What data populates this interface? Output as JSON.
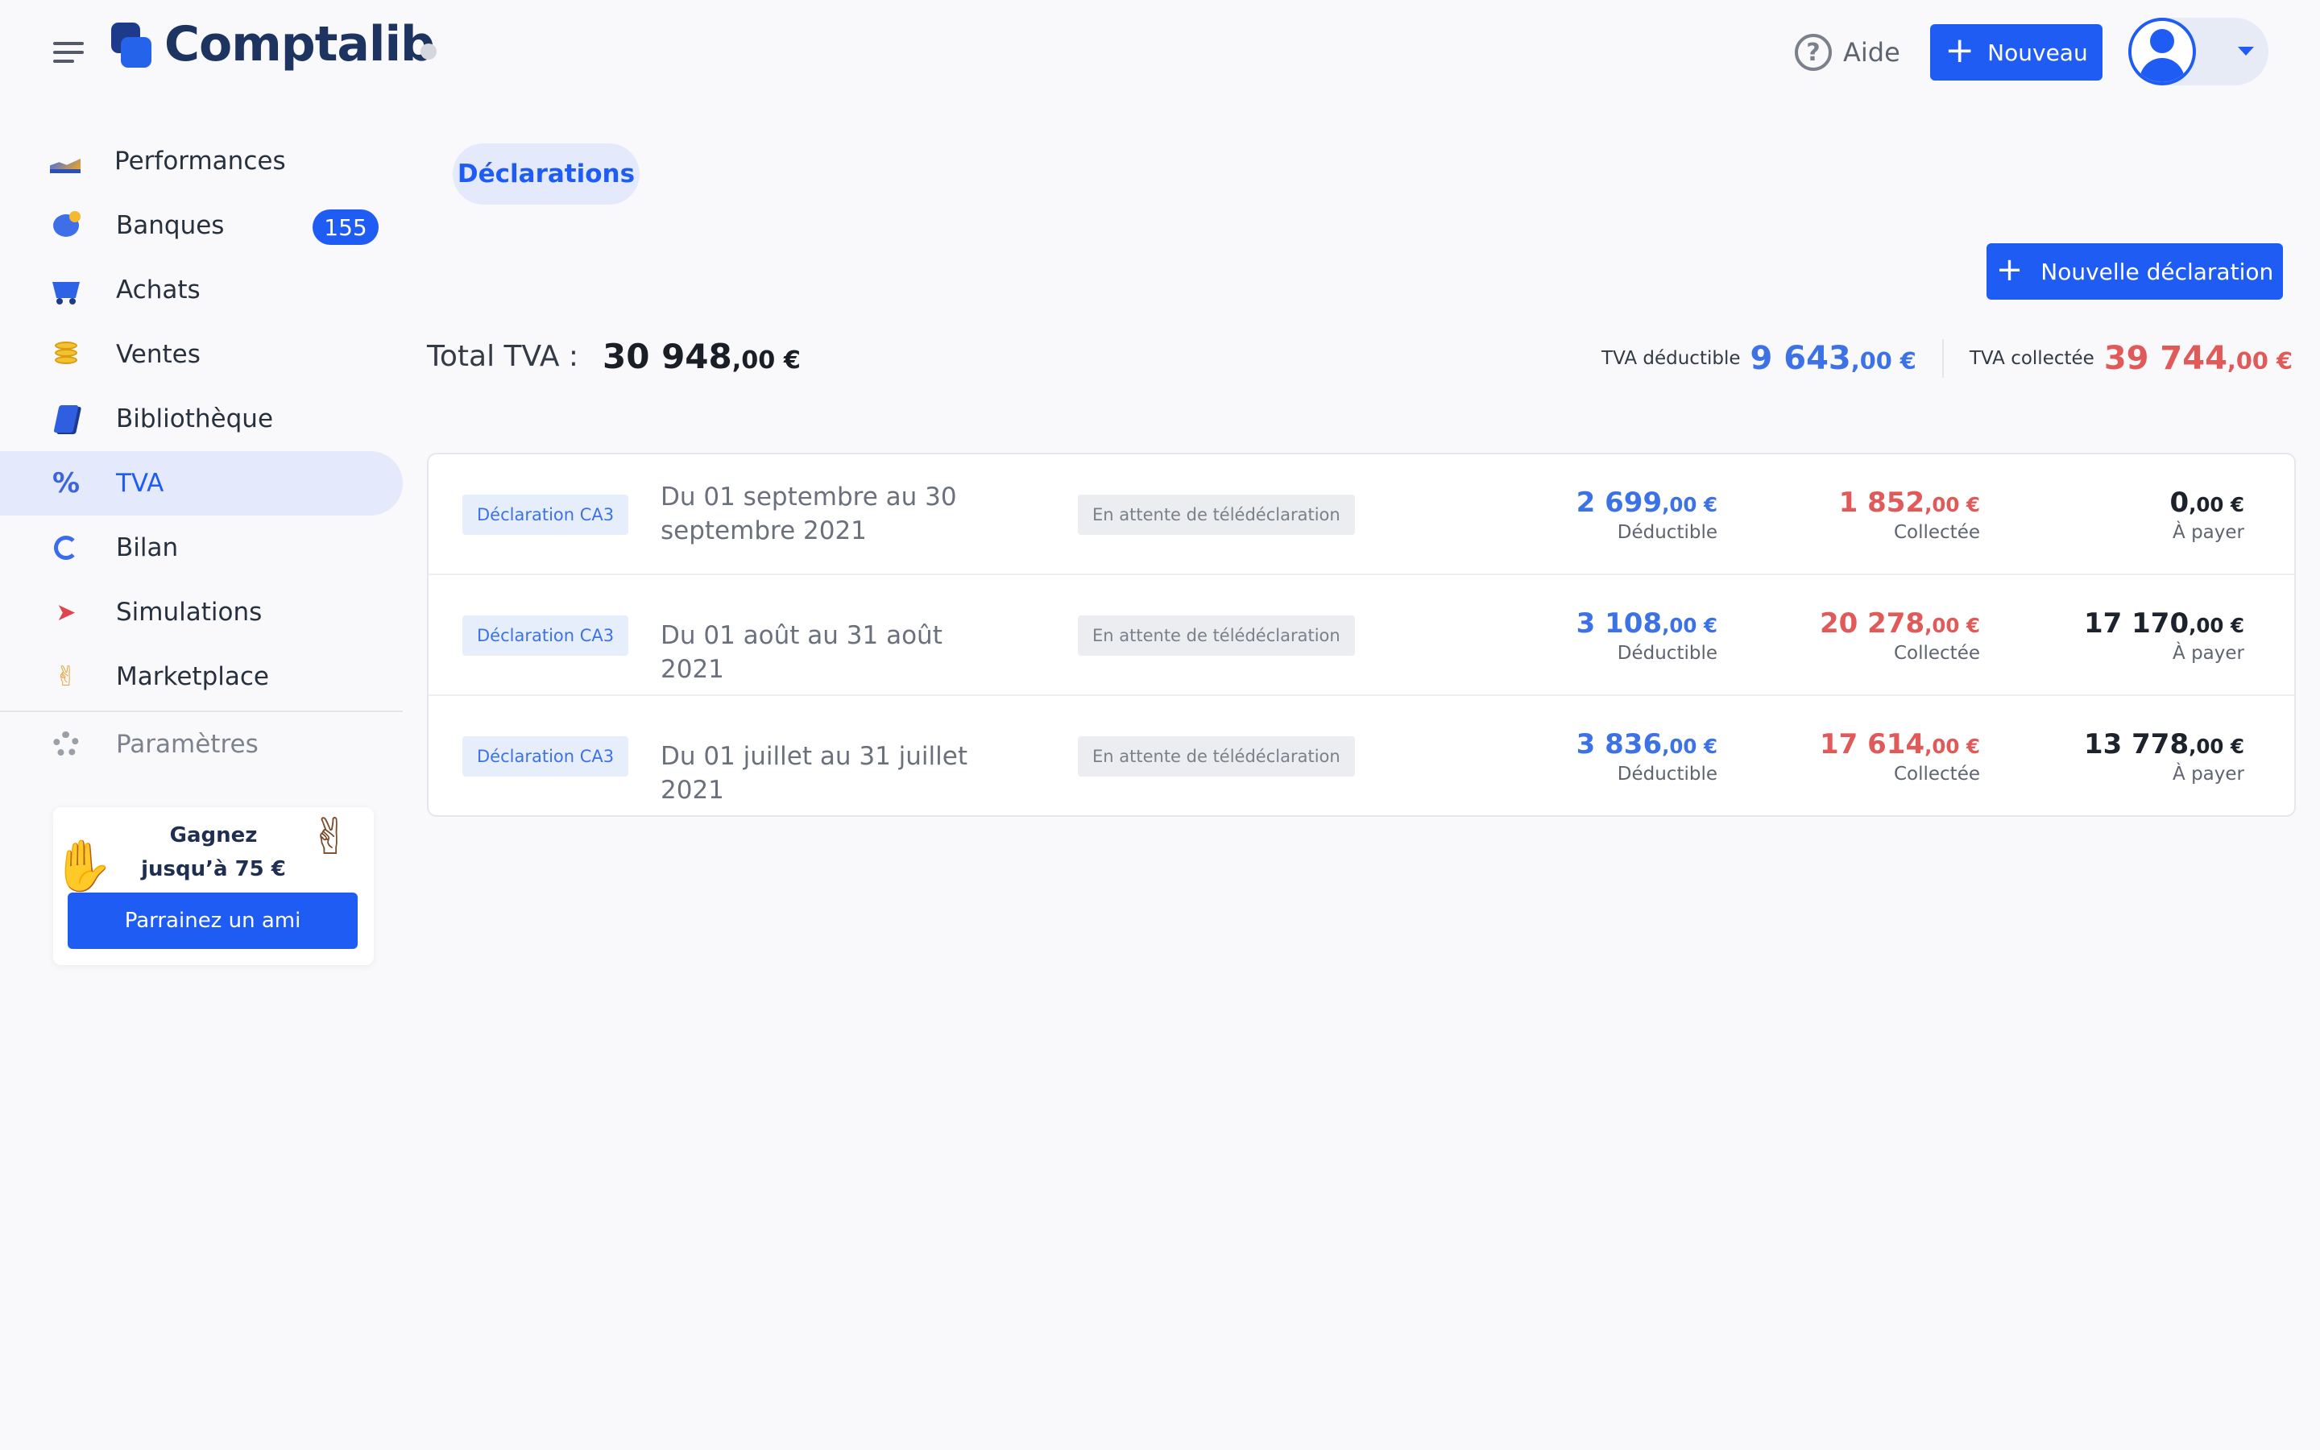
{
  "header": {
    "brand": "Comptalib",
    "help_label": "Aide",
    "help_icon": "?",
    "new_button_label": "Nouveau"
  },
  "sidebar": {
    "items": [
      {
        "label": "Performances",
        "icon": "chart-icon"
      },
      {
        "label": "Banques",
        "icon": "piggy-bank-icon",
        "badge": "155"
      },
      {
        "label": "Achats",
        "icon": "cart-icon"
      },
      {
        "label": "Ventes",
        "icon": "coins-icon"
      },
      {
        "label": "Bibliothèque",
        "icon": "book-icon"
      },
      {
        "label": "TVA",
        "icon": "percent-icon",
        "active": true
      },
      {
        "label": "Bilan",
        "icon": "pen-icon"
      },
      {
        "label": "Simulations",
        "icon": "rocket-icon"
      },
      {
        "label": "Marketplace",
        "icon": "handshake-icon"
      },
      {
        "label": "Paramètres",
        "icon": "gear-icon"
      }
    ],
    "promo": {
      "line1": "Gagnez",
      "line2": "jusqu’à 75 €",
      "button_label": "Parrainez un ami"
    }
  },
  "main": {
    "tab_label": "Déclarations",
    "new_declaration_label": "Nouvelle déclaration",
    "total_label": "Total TVA :",
    "total_int": "30 948",
    "total_dec": ",00 €",
    "deductible_label": "TVA déductible",
    "deductible_int": "9 643",
    "deductible_dec": ",00 €",
    "collected_label": "TVA collectée",
    "collected_int": "39 744",
    "collected_dec": ",00 €",
    "rows": [
      {
        "type": "Déclaration CA3",
        "period_line1": "Du 01 septembre au 30",
        "period_line2": "septembre 2021",
        "status": "En attente de télédéclaration",
        "ded_int": "2 699",
        "ded_dec": ",00 €",
        "ded_label": "Déductible",
        "col_int": "1 852",
        "col_dec": ",00 €",
        "col_label": "Collectée",
        "pay_int": "0",
        "pay_dec": ",00 €",
        "pay_label": "À payer"
      },
      {
        "type": "Déclaration CA3",
        "period_line1": "Du 01 août au 31 août 2021",
        "period_line2": "",
        "status": "En attente de télédéclaration",
        "ded_int": "3 108",
        "ded_dec": ",00 €",
        "ded_label": "Déductible",
        "col_int": "20 278",
        "col_dec": ",00 €",
        "col_label": "Collectée",
        "pay_int": "17 170",
        "pay_dec": ",00 €",
        "pay_label": "À payer"
      },
      {
        "type": "Déclaration CA3",
        "period_line1": "Du 01 juillet au 31 juillet 2021",
        "period_line2": "",
        "status": "En attente de télédéclaration",
        "ded_int": "3 836",
        "ded_dec": ",00 €",
        "ded_label": "Déductible",
        "col_int": "17 614",
        "col_dec": ",00 €",
        "col_label": "Collectée",
        "pay_int": "13 778",
        "pay_dec": ",00 €",
        "pay_label": "À payer"
      }
    ]
  },
  "colors": {
    "accent": "#1f5cf4",
    "deductible": "#3d72e6",
    "collected": "#e05a5a",
    "brand": "#1d3461"
  }
}
